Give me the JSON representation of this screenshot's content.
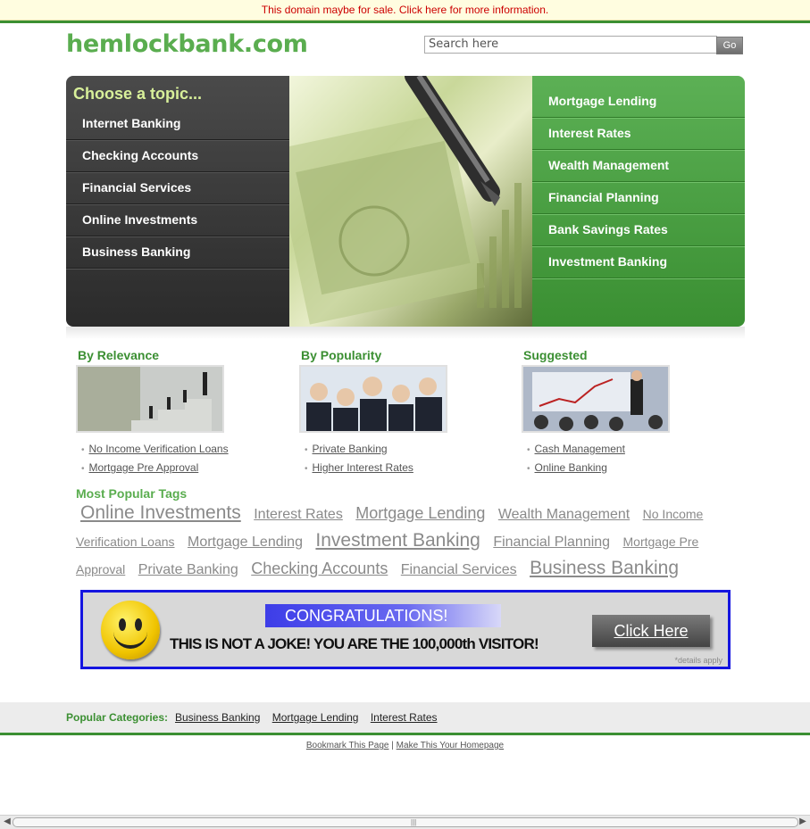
{
  "sale_bar": {
    "text": "This domain maybe for sale. Click here for more information."
  },
  "header": {
    "logo": "hemlockbank.com",
    "search_placeholder": "Search here",
    "go_label": "Go"
  },
  "hero": {
    "topic_title": "Choose a topic...",
    "left_items": [
      "Internet Banking",
      "Checking Accounts",
      "Financial Services",
      "Online Investments",
      "Business Banking"
    ],
    "right_items": [
      "Mortgage Lending",
      "Interest Rates",
      "Wealth Management",
      "Financial Planning",
      "Bank Savings Rates",
      "Investment Banking"
    ]
  },
  "columns": [
    {
      "title": "By Relevance",
      "links": [
        "No Income Verification Loans",
        "Mortgage Pre Approval"
      ]
    },
    {
      "title": "By Popularity",
      "links": [
        "Private Banking",
        "Higher Interest Rates"
      ]
    },
    {
      "title": "Suggested",
      "links": [
        "Cash Management",
        "Online Banking"
      ]
    }
  ],
  "tags": {
    "title": "Most Popular Tags",
    "items": [
      "Online Investments",
      "Interest Rates",
      "Mortgage Lending",
      "Wealth Management",
      "No Income Verification Loans",
      "Mortgage Lending",
      "Investment Banking",
      "Financial Planning",
      "Mortgage Pre Approval",
      "Private Banking",
      "Checking Accounts",
      "Financial Services",
      "Business Banking"
    ]
  },
  "banner": {
    "headline": "CONGRATULATIONS!",
    "subline": "THIS IS NOT A JOKE! YOU ARE THE 100,000th VISITOR!",
    "button": "Click Here",
    "fine_print": "*details apply"
  },
  "footer": {
    "popular_label": "Popular Categories:",
    "popular_links": [
      "Business Banking",
      "Mortgage Lending",
      "Interest Rates"
    ],
    "bookmark": "Bookmark This Page",
    "separator": "|",
    "homepage": "Make This Your Homepage"
  },
  "colors": {
    "brand_green": "#3b8f32",
    "logo_green": "#5aad4f",
    "sale_red": "#cc0000",
    "banner_blue": "#1515e0"
  }
}
